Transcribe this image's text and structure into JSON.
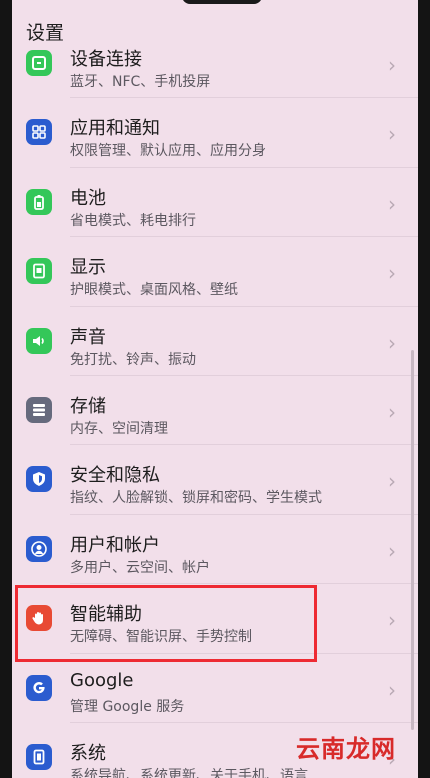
{
  "header": {
    "title": "设置"
  },
  "items": [
    {
      "title": "设备连接",
      "subtitle": "蓝牙、NFC、手机投屏",
      "icon": "device-connection-icon",
      "color": "#34c759"
    },
    {
      "title": "应用和通知",
      "subtitle": "权限管理、默认应用、应用分身",
      "icon": "apps-icon",
      "color": "#2b5ccf"
    },
    {
      "title": "电池",
      "subtitle": "省电模式、耗电排行",
      "icon": "battery-icon",
      "color": "#34c759"
    },
    {
      "title": "显示",
      "subtitle": "护眼模式、桌面风格、壁纸",
      "icon": "display-icon",
      "color": "#34c759"
    },
    {
      "title": "声音",
      "subtitle": "免打扰、铃声、振动",
      "icon": "sound-icon",
      "color": "#34c759"
    },
    {
      "title": "存储",
      "subtitle": "内存、空间清理",
      "icon": "storage-icon",
      "color": "#666a7d"
    },
    {
      "title": "安全和隐私",
      "subtitle": "指纹、人脸解锁、锁屏和密码、学生模式",
      "icon": "security-shield-icon",
      "color": "#2b5ccf"
    },
    {
      "title": "用户和帐户",
      "subtitle": "多用户、云空间、帐户",
      "icon": "user-icon",
      "color": "#2b5ccf"
    },
    {
      "title": "智能辅助",
      "subtitle": "无障碍、智能识屏、手势控制",
      "icon": "hand-icon",
      "color": "#e84a34"
    },
    {
      "title": "Google",
      "subtitle": "管理 Google 服务",
      "icon": "google-icon",
      "color": "#2b5ccf"
    },
    {
      "title": "系统",
      "subtitle": "系统导航、系统更新、关于手机、语言",
      "icon": "system-icon",
      "color": "#2b5ccf"
    }
  ],
  "watermark": "云南龙网"
}
